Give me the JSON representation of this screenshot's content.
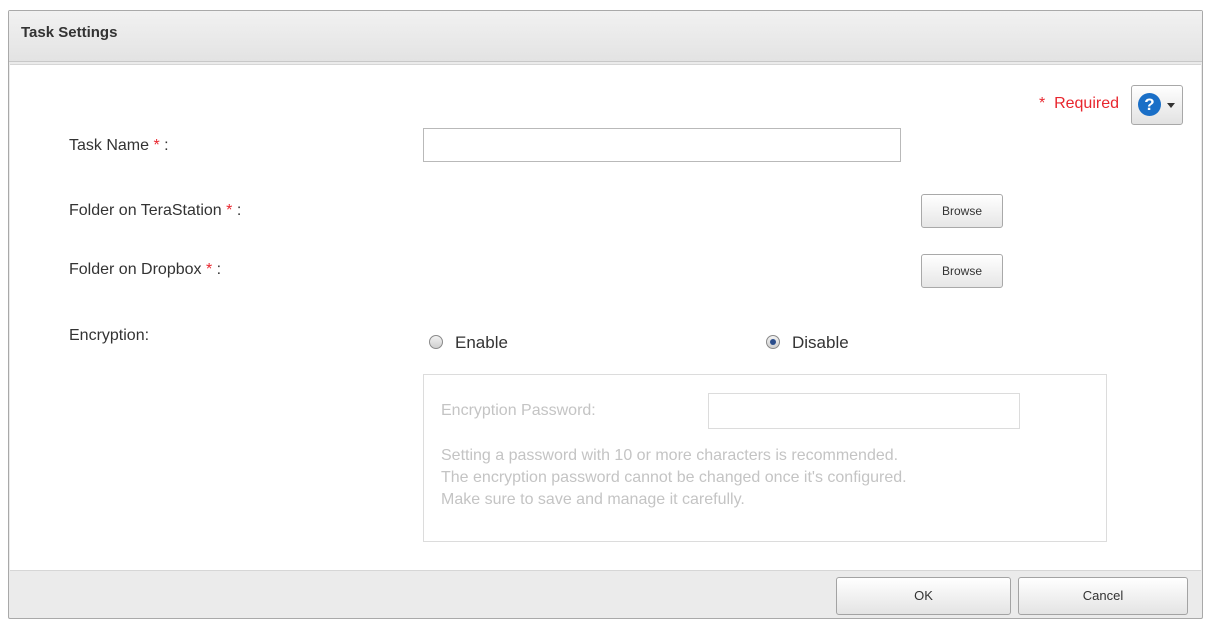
{
  "dialog": {
    "title": "Task Settings",
    "required_label": "Required",
    "required_star": "*",
    "help_icon": "question-circle-icon"
  },
  "form": {
    "task_name_label": "Task Name",
    "task_name_value": "",
    "folder_terastation_label": "Folder on TeraStation",
    "folder_dropbox_label": "Folder on Dropbox",
    "star": "*",
    "colon": " :",
    "browse_label": "Browse",
    "encryption_label": "Encryption:",
    "enable_label": "Enable",
    "disable_label": "Disable",
    "selected_encryption": "Disable"
  },
  "encryption_box": {
    "password_label": "Encryption Password:",
    "password_value": "",
    "note_line1": "Setting a password with 10 or more characters is recommended.",
    "note_line2": "The encryption password cannot be changed once it's configured.",
    "note_line3": "Make sure to save and manage it carefully."
  },
  "footer": {
    "ok_label": "OK",
    "cancel_label": "Cancel"
  },
  "colors": {
    "required": "#e8262e",
    "help_icon": "#1a6fc7",
    "disabled_text": "#c4c4c4"
  }
}
